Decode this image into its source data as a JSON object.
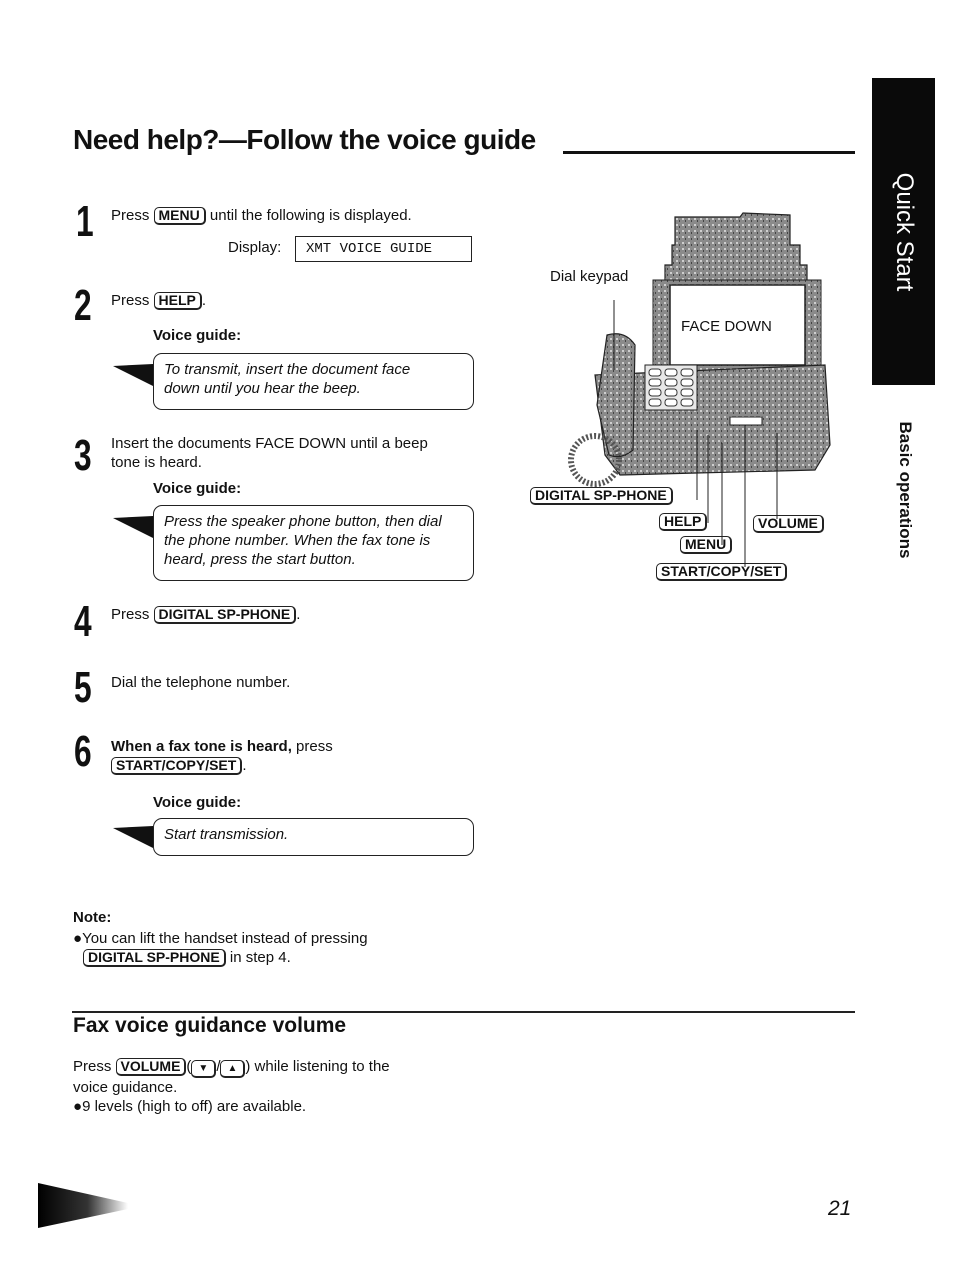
{
  "page": {
    "title": "Need help?—Follow the voice guide",
    "page_number": "21"
  },
  "side_tabs": {
    "active": "Quick Start",
    "section": "Basic operations"
  },
  "steps": [
    {
      "number": "1",
      "prefix": "Press",
      "key": "MENU",
      "suffix": "until the following is displayed.",
      "display_label": "Display:",
      "display_value": "XMT VOICE GUIDE"
    },
    {
      "number": "2",
      "prefix": "Press",
      "key": "HELP",
      "suffix": ".",
      "voice_guide_label": "Voice guide:",
      "voice_guide_lines": [
        "To transmit, insert the document face",
        "down until you hear the beep."
      ]
    },
    {
      "number": "3",
      "lines": [
        "Insert the documents FACE DOWN until a beep",
        "tone is heard."
      ],
      "voice_guide_label": "Voice guide:",
      "voice_guide_lines": [
        "Press the speaker phone button, then dial",
        "the phone number. When the fax tone is",
        "heard, press the start button."
      ]
    },
    {
      "number": "4",
      "prefix": "Press",
      "key": "DIGITAL SP-PHONE",
      "suffix": "."
    },
    {
      "number": "5",
      "text": "Dial the telephone number."
    },
    {
      "number": "6",
      "bold_prefix": "When a fax tone is heard,",
      "prefix": "press",
      "key": "START/COPY/SET",
      "suffix": ".",
      "voice_guide_label": "Voice guide:",
      "voice_guide_lines": [
        "Start transmission."
      ]
    }
  ],
  "illustration": {
    "dial_keypad_label": "Dial keypad",
    "document_label": "FACE DOWN",
    "callouts": {
      "digital_sp_phone": "DIGITAL SP-PHONE",
      "help": "HELP",
      "menu": "MENU",
      "volume": "VOLUME",
      "start_copy_set": "START/COPY/SET"
    }
  },
  "note": {
    "label": "Note:",
    "line1": "You can lift the handset instead of pressing",
    "key": "DIGITAL SP-PHONE",
    "line2_suffix": "in step 4."
  },
  "volume_section": {
    "title": "Fax voice guidance volume",
    "prefix": "Press",
    "key": "VOLUME",
    "open_paren": "(",
    "down_key": "▼",
    "slash": "/",
    "up_key": "▲",
    "close_suffix": ") while listening to the",
    "line2": "voice guidance.",
    "bullet": "9 levels (high to off) are available."
  }
}
